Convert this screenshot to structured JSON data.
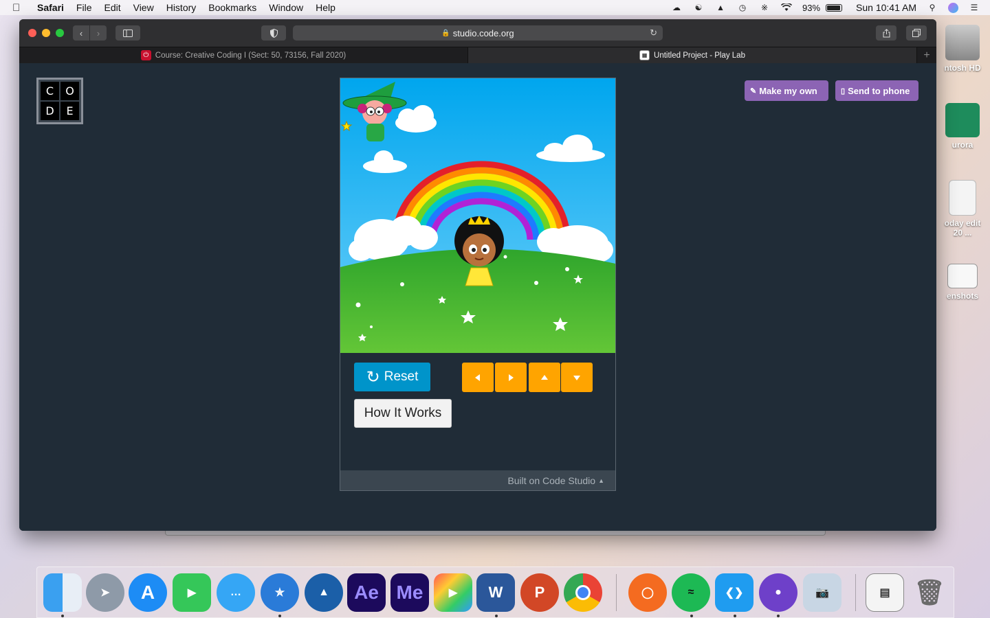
{
  "menubar": {
    "app": "Safari",
    "items": [
      "File",
      "Edit",
      "View",
      "History",
      "Bookmarks",
      "Window",
      "Help"
    ],
    "battery": "93%",
    "clock": "Sun 10:41 AM"
  },
  "desktop_icons": [
    {
      "label": "ntosh HD"
    },
    {
      "label": "urora"
    },
    {
      "label": "oday edit",
      "sub": "20 ..."
    },
    {
      "label": "enshots"
    }
  ],
  "browser": {
    "url": "studio.code.org",
    "tabs": [
      {
        "title": "Course: Creative Coding I (Sect: 50, 73156, Fall 2020)",
        "active": false
      },
      {
        "title": "Untitled Project - Play Lab",
        "active": true
      }
    ]
  },
  "page": {
    "logo_letters": [
      "C",
      "O",
      "D",
      "E"
    ],
    "make_my_own": "Make my own",
    "send_to_phone": "Send to phone",
    "reset": "Reset",
    "how_it_works": "How It Works",
    "footer": "Built on Code Studio"
  },
  "dock": {
    "apps": [
      "Finder",
      "Launchpad",
      "App Store",
      "FaceTime",
      "Messages",
      "Safari",
      "Mountain",
      "Ae",
      "Me",
      "Final Cut Pro",
      "W",
      "P",
      "Chrome",
      "Origin",
      "Spotify",
      "VS Code",
      "GitHub",
      "Preview",
      "Screen",
      "Trash"
    ]
  },
  "colors": {
    "reset_blue": "#0094ca",
    "arrow_orange": "#ffa400",
    "action_purple": "#8c64b4",
    "page_bg": "#202c37"
  }
}
